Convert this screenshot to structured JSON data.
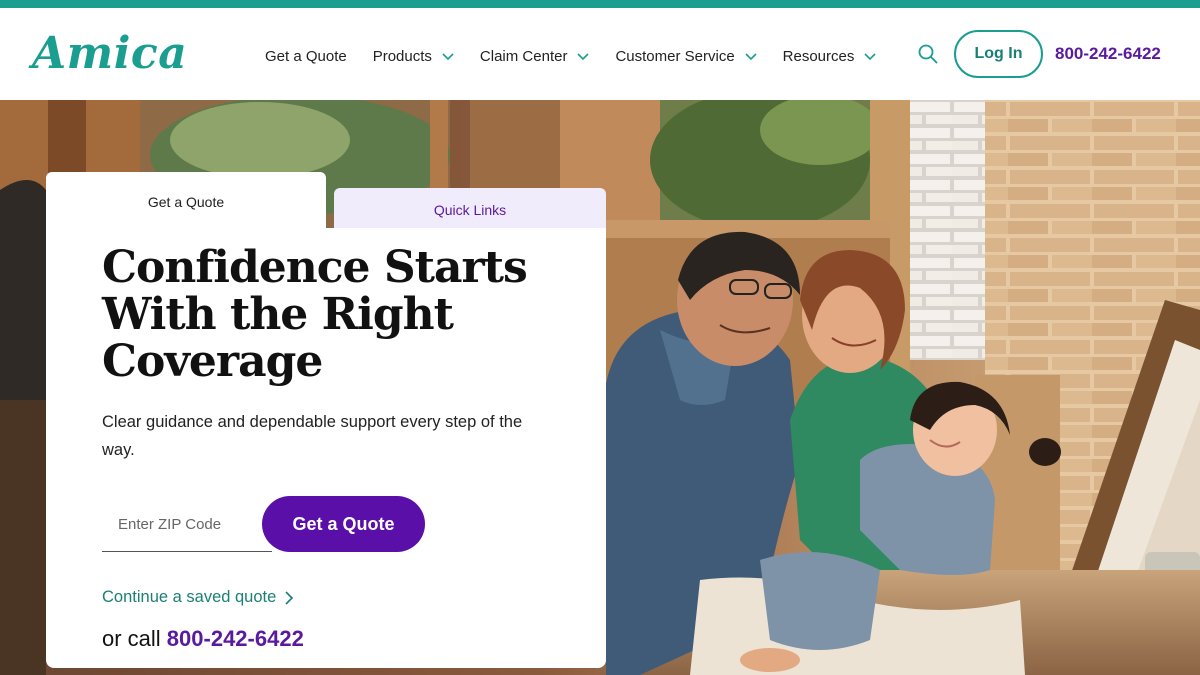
{
  "brand": {
    "logo_text": "Amica",
    "accent_color": "#1a9e8f",
    "purple_color": "#5a0fa8"
  },
  "header": {
    "nav": [
      {
        "label": "Get a Quote",
        "has_dropdown": false
      },
      {
        "label": "Products",
        "has_dropdown": true
      },
      {
        "label": "Claim Center",
        "has_dropdown": true
      },
      {
        "label": "Customer Service",
        "has_dropdown": true
      },
      {
        "label": "Resources",
        "has_dropdown": true
      }
    ],
    "search_icon": "search-icon",
    "login_label": "Log In",
    "phone": "800-242-6422"
  },
  "hero_card": {
    "tabs": [
      {
        "label": "Get a Quote",
        "active": true
      },
      {
        "label": "Quick Links",
        "active": false
      }
    ],
    "title": "Confidence Starts With the Right Coverage",
    "subtitle": "Clear guidance and dependable support every step of the way.",
    "zip_placeholder": "Enter ZIP Code",
    "zip_value": "",
    "quote_button": "Get a Quote",
    "saved_quote_link": "Continue a saved quote",
    "call_prefix": "or call",
    "call_phone": "800-242-6422"
  }
}
